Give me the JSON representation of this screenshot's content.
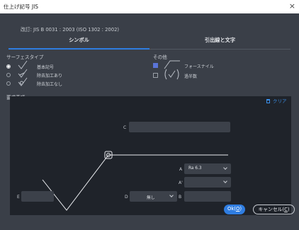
{
  "window": {
    "title": "仕上げ記号 JIS",
    "close_glyph": "×"
  },
  "revision": "改訂: JIS B 0031 : 2003 (ISO 1302 : 2002)",
  "tabs": [
    {
      "label": "シンボル",
      "selected": true
    },
    {
      "label": "引出線と文字",
      "selected": false
    }
  ],
  "surface_type": {
    "label": "サーフェスタイプ",
    "options": [
      {
        "label": "基本記号",
        "selected": true
      },
      {
        "label": "除去加工あり",
        "selected": false
      },
      {
        "label": "除去加工なし",
        "selected": false
      }
    ]
  },
  "other": {
    "label": "その他",
    "options": [
      {
        "label": "フォースナイル",
        "checked": true
      },
      {
        "label": "過半数",
        "checked": false
      }
    ]
  },
  "requirements": {
    "label": "要求事項",
    "clear_label": "クリア",
    "fields": {
      "C": {
        "label": "C",
        "value": ""
      },
      "A": {
        "label": "A",
        "value": "Ra 6.3"
      },
      "A2": {
        "label": "A'",
        "value": ""
      },
      "D": {
        "label": "D",
        "value": "無し"
      },
      "B": {
        "label": "B",
        "value": ""
      },
      "E": {
        "label": "E",
        "value": ""
      }
    }
  },
  "buttons": {
    "ok_main": "Ok(",
    "ok_key": "O",
    "ok_end": ")",
    "cancel_main": "キャンセル(",
    "cancel_key": "C",
    "cancel_end": ")"
  },
  "colors": {
    "accent": "#2f7de1",
    "background": "#3a3f48",
    "canvas": "#1f232a"
  }
}
